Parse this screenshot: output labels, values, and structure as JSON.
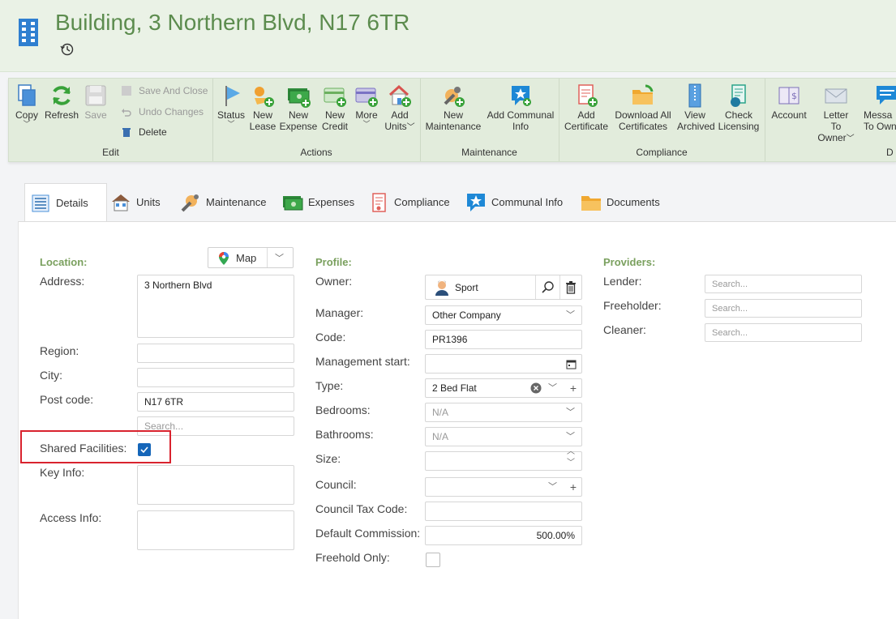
{
  "header": {
    "title": "Building, 3 Northern Blvd, N17 6TR"
  },
  "ribbon": {
    "edit": {
      "label": "Edit",
      "copy": "Copy",
      "refresh": "Refresh",
      "save": "Save",
      "save_close": "Save And Close",
      "undo": "Undo Changes",
      "delete": "Delete"
    },
    "actions": {
      "label": "Actions",
      "status": "Status",
      "new_lease": [
        "New",
        "Lease"
      ],
      "new_expense": [
        "New",
        "Expense"
      ],
      "new_credit": [
        "New",
        "Credit"
      ],
      "more": "More",
      "add_units": [
        "Add",
        "Units"
      ]
    },
    "maintenance": {
      "label": "Maintenance",
      "new_maintenance": [
        "New",
        "Maintenance"
      ],
      "add_communal": [
        "Add Communal",
        "Info"
      ]
    },
    "compliance": {
      "label": "Compliance",
      "add_cert": [
        "Add",
        "Certificate"
      ],
      "download_all": [
        "Download All",
        "Certificates"
      ],
      "view_archived": [
        "View",
        "Archived"
      ],
      "check_licensing": [
        "Check",
        "Licensing"
      ]
    },
    "docs": {
      "label": "D",
      "account": "Account",
      "letter": [
        "Letter",
        "To Owner"
      ],
      "message": [
        "Messa",
        "To Own"
      ]
    }
  },
  "tabs": [
    "Details",
    "Units",
    "Maintenance",
    "Expenses",
    "Compliance",
    "Communal Info",
    "Documents"
  ],
  "location": {
    "heading": "Location:",
    "map_label": "Map",
    "address_label": "Address:",
    "address": "3 Northern Blvd",
    "region_label": "Region:",
    "city_label": "City:",
    "postcode_label": "Post code:",
    "postcode": "N17 6TR",
    "search_placeholder": "Search...",
    "shared_label": "Shared Facilities:",
    "keyinfo_label": "Key Info:",
    "access_label": "Access Info:"
  },
  "profile": {
    "heading": "Profile:",
    "owner_label": "Owner:",
    "owner": "Sport",
    "manager_label": "Manager:",
    "manager": "Other Company",
    "code_label": "Code:",
    "code": "PR1396",
    "mgmt_start_label": "Management start:",
    "type_label": "Type:",
    "type": "2 Bed Flat",
    "bedrooms_label": "Bedrooms:",
    "bedrooms": "N/A",
    "bathrooms_label": "Bathrooms:",
    "bathrooms": "N/A",
    "size_label": "Size:",
    "council_label": "Council:",
    "council_tax_label": "Council Tax Code:",
    "commission_label": "Default Commission:",
    "commission": "500.00%",
    "freehold_label": "Freehold Only:"
  },
  "providers": {
    "heading": "Providers:",
    "lender_label": "Lender:",
    "freeholder_label": "Freeholder:",
    "cleaner_label": "Cleaner:",
    "placeholder": "Search..."
  }
}
